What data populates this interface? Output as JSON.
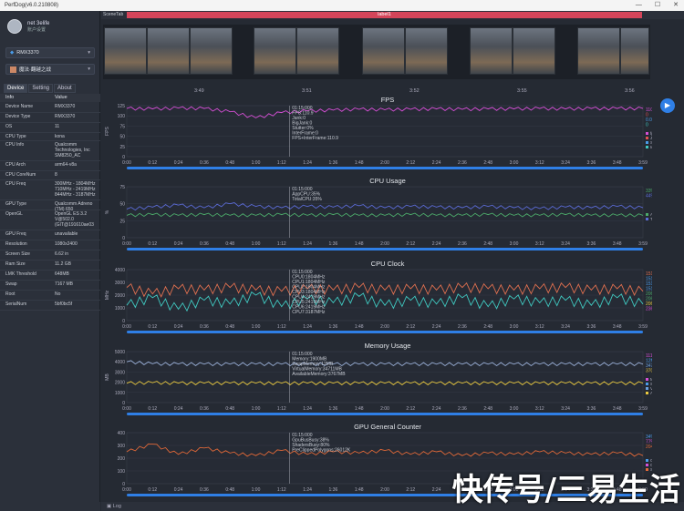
{
  "window": {
    "title": "PerfDog(v6.0.210808)",
    "controls": [
      "—",
      "☐",
      "✕"
    ]
  },
  "user": {
    "name": "net 3elife",
    "sub": "账户设置"
  },
  "device_select": {
    "value": "RMX3370"
  },
  "app_select": {
    "value": "魔法·翻越之战"
  },
  "tabs": [
    "Device",
    "Setting",
    "About"
  ],
  "info_header": {
    "key": "Info",
    "value": "Value"
  },
  "info_rows": [
    {
      "k": "Device Name",
      "v": "RMX3370"
    },
    {
      "k": "Device Type",
      "v": "RMX3370"
    },
    {
      "k": "OS",
      "v": "11"
    },
    {
      "k": "CPU Type",
      "v": "kona"
    },
    {
      "k": "CPU Info",
      "v": "Qualcomm Technologies, Inc SM8250_AC"
    },
    {
      "k": "CPU Arch",
      "v": "arm64-v8a"
    },
    {
      "k": "CPU CoreNum",
      "v": "8"
    },
    {
      "k": "CPU Freq",
      "v": "300MHz - 1804MHz 710MHz - 2419MHz 844MHz - 3187MHz"
    },
    {
      "k": "GPU Type",
      "v": "Qualcomm Adreno (TM) 650"
    },
    {
      "k": "OpenGL",
      "v": "OpenGL ES 3.2 V@502.0 (GIT@191610ae03"
    },
    {
      "k": "GPU Freq",
      "v": "unavailable"
    },
    {
      "k": "Resolution",
      "v": "1080x2400"
    },
    {
      "k": "Screen Size",
      "v": "6.62 in"
    },
    {
      "k": "Ram Size",
      "v": "11.2 GB"
    },
    {
      "k": "LMK Threshold",
      "v": "648MB"
    },
    {
      "k": "Swap",
      "v": "7167 MB"
    },
    {
      "k": "Root",
      "v": "No"
    },
    {
      "k": "SerialNum",
      "v": "5bf0bc5f"
    }
  ],
  "scene": {
    "tab_label": "SceneTab",
    "label": "label1",
    "times": [
      "3:49",
      "3:51",
      "3:52",
      "3:55",
      "3:56"
    ]
  },
  "time_ticks": [
    "0:00",
    "0:12",
    "0:24",
    "0:36",
    "0:48",
    "1:00",
    "1:12",
    "1:24",
    "1:36",
    "1:48",
    "2:00",
    "2:12",
    "2:24",
    "2:36",
    "2:48",
    "3:00",
    "3:12",
    "3:24",
    "3:36",
    "3:48",
    "3:59"
  ],
  "bottom": {
    "log": "Log"
  },
  "watermark": "快传号/三易生活",
  "colors": {
    "fps": "#d64fd6",
    "jank": "#e8a23a",
    "cpu_app": "#5b6bd6",
    "cpu_total": "#4caa6a",
    "clk_a": "#e07050",
    "clk_b": "#40c8c0",
    "mem": "#e8c840",
    "gpu": "#e06838"
  },
  "chart_data": [
    {
      "type": "line",
      "title": "FPS",
      "ylabel": "FPS",
      "ylim": [
        0,
        125
      ],
      "yticks": [
        0,
        25,
        50,
        75,
        100,
        125
      ],
      "tooltip": [
        "01:15:000",
        "FPS:110.9",
        "Jank:0",
        "BigJank:0",
        "Stutter:0%",
        "InterFrame:0",
        "FPS+InterFrame:110.9"
      ],
      "legend_values": [
        "110.9",
        "0",
        "0.00",
        "0"
      ],
      "legend": [
        "fps",
        "Jank(HESB)",
        "Stutter(HESB)",
        "InterFrame"
      ],
      "series": [
        {
          "name": "fps",
          "values": [
            118,
            117,
            119,
            118,
            110,
            95,
            108,
            112,
            114,
            116,
            115,
            116,
            117,
            116,
            117,
            117,
            118,
            117,
            118,
            118,
            118
          ]
        }
      ]
    },
    {
      "type": "line",
      "title": "CPU Usage",
      "ylabel": "%",
      "ylim": [
        0,
        75
      ],
      "yticks": [
        0,
        25,
        50,
        75
      ],
      "tooltip": [
        "01:15:000",
        "AppCPU:35%",
        "TotalCPU:35%"
      ],
      "legend_values": [
        "33%",
        "44%"
      ],
      "legend": [
        "AppCPU",
        "TotalCPU"
      ],
      "series": [
        {
          "name": "AppCPU",
          "values": [
            42,
            45,
            48,
            44,
            50,
            46,
            44,
            46,
            45,
            47,
            44,
            46,
            45,
            44,
            46,
            44,
            43,
            45,
            44,
            46,
            44
          ]
        },
        {
          "name": "TotalCPU",
          "values": [
            33,
            34,
            33,
            34,
            33,
            33,
            34,
            33,
            34,
            33,
            33,
            34,
            33,
            33,
            34,
            33,
            33,
            34,
            33,
            33,
            33
          ]
        }
      ]
    },
    {
      "type": "line",
      "title": "CPU Clock",
      "ylabel": "MHz",
      "ylim": [
        0,
        4000
      ],
      "yticks": [
        0,
        1000,
        2000,
        3000,
        4000
      ],
      "tooltip": [
        "01:15:000",
        "CPU0:1804MHz",
        "CPU1:1804MHz",
        "CPU2:1804MHz",
        "CPU3:1804MHz",
        "CPU4:2419MHz",
        "CPU5:2419MHz",
        "CPU6:2419MHz",
        "CPU7:3187MHz"
      ],
      "legend_values": [
        "1516MHz",
        "1516MHz",
        "1516MHz",
        "1516MHz",
        "2064MHz",
        "2064MHz",
        "2064MHz",
        "2361MHz"
      ],
      "legend": [],
      "series": [
        {
          "name": "",
          "values": [
            2600,
            2100,
            2500,
            2400,
            2600,
            2400,
            2300,
            2500,
            2400,
            2600,
            2400,
            2500,
            2400,
            2600,
            2500,
            2400,
            2500,
            2600,
            2400,
            2500,
            2300
          ]
        },
        {
          "name": "",
          "values": [
            1200,
            1800,
            900,
            1600,
            1300,
            2000,
            1100,
            1700,
            1400,
            1900,
            1200,
            1600,
            1300,
            1800,
            1100,
            1700,
            1400,
            1600,
            1200,
            1800,
            1300
          ]
        }
      ]
    },
    {
      "type": "line",
      "title": "Memory Usage",
      "ylabel": "MB",
      "ylim": [
        0,
        5000
      ],
      "yticks": [
        0,
        1000,
        2000,
        3000,
        4000,
        5000
      ],
      "tooltip": [
        "01:15:000",
        "Memory:1900MB",
        "SwapMemory:12MB",
        "VirtualMemory:34711MB",
        "AvailableMemory:3767MB"
      ],
      "legend_values": [
        "1119MB",
        "12MB",
        "3472MB",
        "3709MB"
      ],
      "legend": [
        "Memory",
        "SwapMemory",
        "VirtualMemory",
        "AvailableMe..."
      ],
      "series": [
        {
          "name": "Memory",
          "values": [
            1900,
            1950,
            1900,
            1900,
            1900,
            1900,
            1900,
            1900,
            1900,
            1900,
            1900,
            1900,
            1900,
            1900,
            1900,
            1900,
            1900,
            1900,
            1900,
            1900,
            1900
          ]
        },
        {
          "name": "AvailableMemory",
          "values": [
            4000,
            3800,
            3780,
            3770,
            3770,
            3770,
            3770,
            3770,
            3770,
            3770,
            3770,
            3770,
            3770,
            3770,
            3770,
            3770,
            3770,
            3770,
            3770,
            3770,
            3770
          ]
        }
      ]
    },
    {
      "type": "line",
      "title": "GPU General Counter",
      "ylabel": "",
      "ylim": [
        0,
        400
      ],
      "yticks": [
        0,
        100,
        200,
        300,
        400
      ],
      "tooltip": [
        "01:15:000",
        "GpuBusBusy:38%",
        "ShadersBusy:80%",
        "PreClippedPolygons:26012K"
      ],
      "legend_values": [
        "34%",
        "77%",
        "20452K"
      ],
      "legend": [
        "GpuUtilization",
        "GpuBusBusy",
        "ShadersBusy"
      ],
      "series": [
        {
          "name": "",
          "values": [
            250,
            310,
            230,
            280,
            240,
            220,
            260,
            230,
            250,
            240,
            260,
            230,
            250,
            220,
            240,
            230,
            250,
            240,
            230,
            240,
            220
          ]
        }
      ]
    }
  ]
}
